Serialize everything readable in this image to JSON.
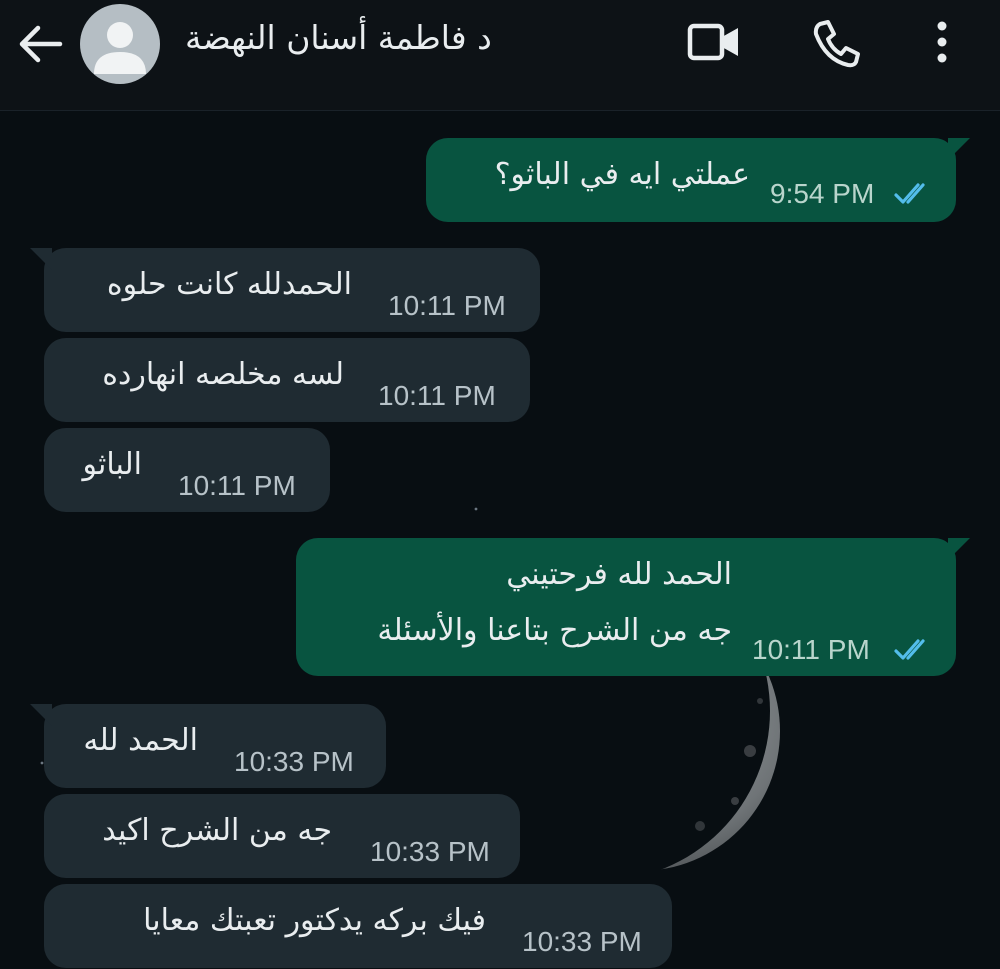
{
  "header": {
    "contact_name": "د فاطمة أسنان النهضة",
    "icons": [
      "back-arrow-icon",
      "avatar-placeholder-icon",
      "video-call-icon",
      "voice-call-icon",
      "more-options-icon"
    ]
  },
  "colors": {
    "incoming_bubble": "#1f2b32",
    "outgoing_bubble": "#085440",
    "read_ticks": "#53bdeb",
    "header_bg": "#0d1216"
  },
  "messages": [
    {
      "direction": "out",
      "lines": [
        "عملتي ايه في الباثو؟"
      ],
      "time": "9:54 PM",
      "status": "read"
    },
    {
      "direction": "in",
      "lines": [
        "الحمدلله كانت حلوه"
      ],
      "time": "10:11 PM"
    },
    {
      "direction": "in",
      "lines": [
        "لسه مخلصه انهارده"
      ],
      "time": "10:11 PM"
    },
    {
      "direction": "in",
      "lines": [
        "الباثو"
      ],
      "time": "10:11 PM"
    },
    {
      "direction": "out",
      "lines": [
        "الحمد لله فرحتيني",
        "جه من الشرح بتاعنا والأسئلة"
      ],
      "time": "10:11 PM",
      "status": "read"
    },
    {
      "direction": "in",
      "lines": [
        "الحمد لله"
      ],
      "time": "10:33 PM"
    },
    {
      "direction": "in",
      "lines": [
        "جه من الشرح اكيد"
      ],
      "time": "10:33 PM"
    },
    {
      "direction": "in",
      "lines": [
        "فيك بركه يدكتور تعبتك معايا"
      ],
      "time": "10:33 PM"
    }
  ]
}
